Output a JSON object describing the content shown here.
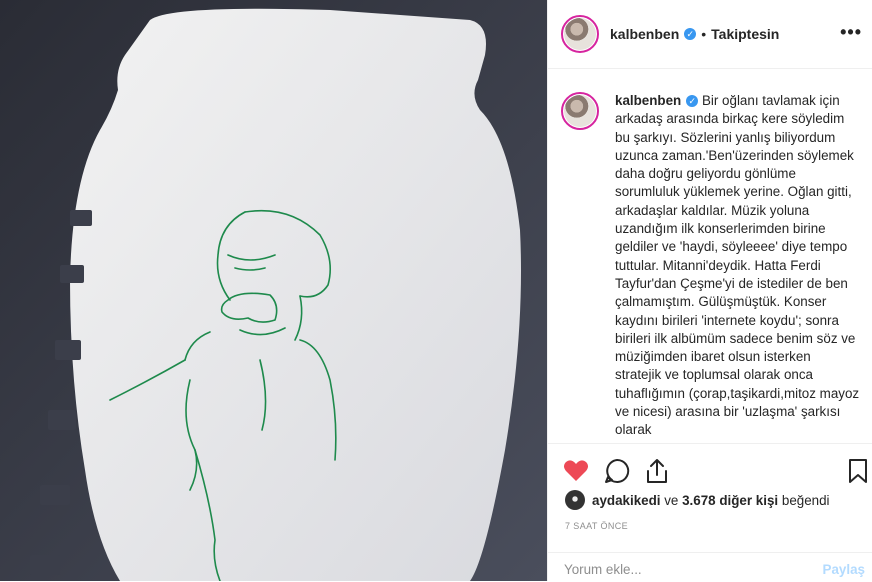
{
  "post": {
    "username": "kalbenben",
    "follow_state": "Takiptesin",
    "more_label": "•••",
    "caption_text": "Bir oğlanı tavlamak için arkadaş arasında birkaç kere söyledim bu şarkıyı. Sözlerini yanlış biliyordum uzunca zaman.'Ben'üzerinden söylemek daha doğru geliyordu gönlüme sorumluluk yüklemek yerine. Oğlan gitti, arkadaşlar kaldılar. Müzik yoluna uzandığım ilk konserlerimden birine geldiler ve 'haydi, söyleeee' diye tempo tuttular. Mitanni'deydik. Hatta Ferdi Tayfur'dan Çeşme'yi de istediler de ben çalmamıştım. Gülüşmüştük. Konser kaydını birileri 'internete koydu'; sonra birileri ilk albümüm sadece benim söz ve müziğimden ibaret olsun isterken stratejik ve toplumsal olarak onca tuhaflığımın (çorap,taşikardi,mitoz mayoz ve nicesi) arasına bir 'uzlaşma' şarkısı olarak",
    "likes_user": "aydakikedi",
    "likes_and": "ve",
    "likes_count": "3.678 diğer kişi",
    "likes_suffix": "beğendi",
    "timestamp": "7 SAAT ÖNCE",
    "comment_placeholder": "Yorum ekle...",
    "post_button": "Paylaş",
    "liked": true,
    "accent_color": "#ed4956",
    "link_color": "#3897f0"
  }
}
